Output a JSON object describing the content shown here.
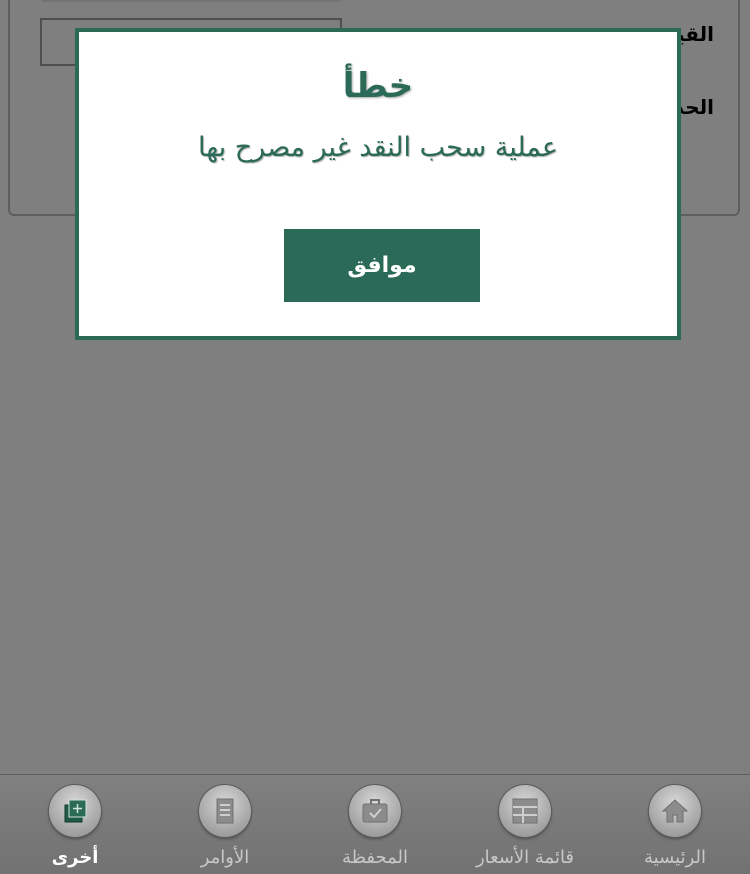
{
  "form": {
    "value_label": "القيمة",
    "quantity_label": "الحد"
  },
  "dialog": {
    "title": "خطأ",
    "message": "عملية سحب النقد غير مصرح بها",
    "ok_label": "موافق"
  },
  "tabs": [
    {
      "label": "الرئيسية",
      "icon": "home-icon",
      "active": false
    },
    {
      "label": "قائمة الأسعار",
      "icon": "price-list-icon",
      "active": false
    },
    {
      "label": "المحفظة",
      "icon": "portfolio-icon",
      "active": false
    },
    {
      "label": "الأوامر",
      "icon": "orders-icon",
      "active": false
    },
    {
      "label": "أخرى",
      "icon": "more-icon",
      "active": true
    }
  ],
  "colors": {
    "accent": "#2b6a57",
    "overlay": "rgba(0,0,0,0.5)"
  }
}
